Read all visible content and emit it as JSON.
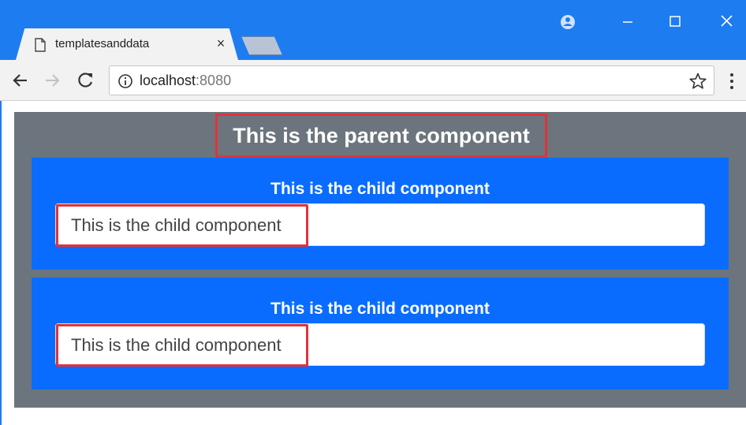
{
  "browser": {
    "tab_title": "templatesanddata",
    "tab_close": "×",
    "url_host": "localhost",
    "url_port": ":8080",
    "accent_color": "#1e7cf1"
  },
  "icons": {
    "tab": "page-icon",
    "profile": "profile-icon",
    "minimize": "minimize-icon",
    "maximize": "maximize-icon",
    "close": "close-icon",
    "back": "back-arrow-icon",
    "forward": "forward-arrow-icon",
    "reload": "reload-icon",
    "info": "info-icon",
    "star": "star-icon",
    "menu": "menu-icon"
  },
  "parent": {
    "title": "This is the parent component",
    "background": "#6c757d"
  },
  "children": [
    {
      "title": "This is the child component",
      "input_value": "This is the child component"
    },
    {
      "title": "This is the child component",
      "input_value": "This is the child component"
    }
  ],
  "colors": {
    "child_background": "#0a6cff",
    "highlight_border": "#e0333c"
  }
}
